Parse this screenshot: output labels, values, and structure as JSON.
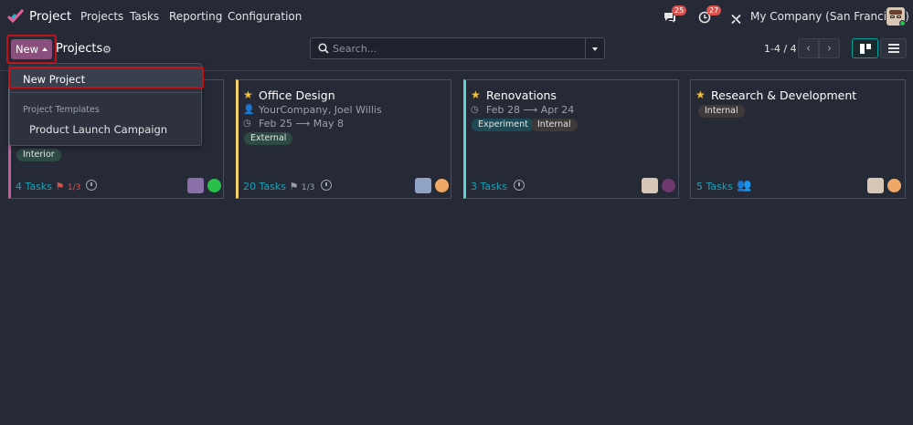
{
  "topnav": {
    "app_name": "Project",
    "menu": [
      "Projects",
      "Tasks",
      "Reporting",
      "Configuration"
    ],
    "messages_badge": "25",
    "activities_badge": "27",
    "company": "My Company (San Francisco)"
  },
  "control_panel": {
    "new_label": "New",
    "title": "Projects",
    "search_placeholder": "Search...",
    "pager": "1-4 / 4"
  },
  "dropdown": {
    "new_project": "New Project",
    "templates_header": "Project Templates",
    "template_item": "Product Launch Campaign"
  },
  "cards": [
    {
      "title": "",
      "tag": "Interior",
      "tasks": "4 Tasks",
      "milestones": "1/3",
      "color": "#c85a9e",
      "dot": "#28c04a"
    },
    {
      "title": "Office Design",
      "customer": "YourCompany, Joel Willis",
      "date_start": "Feb 25",
      "date_end": "May 8",
      "tag": "External",
      "tasks": "20 Tasks",
      "milestones": "1/3",
      "color": "#f3d36a",
      "dot": "#f0a868"
    },
    {
      "title": "Renovations",
      "date_start": "Feb 28",
      "date_end": "Apr 24",
      "tags": [
        "Experiment",
        "Internal"
      ],
      "tasks": "3 Tasks",
      "color": "#5fd0d0",
      "dot": "#6e3a6e"
    },
    {
      "title": "Research & Development",
      "tag": "Internal",
      "tasks": "5 Tasks",
      "color": "#4a4f5d",
      "dot": "#f0a868"
    }
  ],
  "colors": {
    "accent": "#8a4f7d",
    "teal": "#17a2b8",
    "highlight": "#c0121b"
  }
}
